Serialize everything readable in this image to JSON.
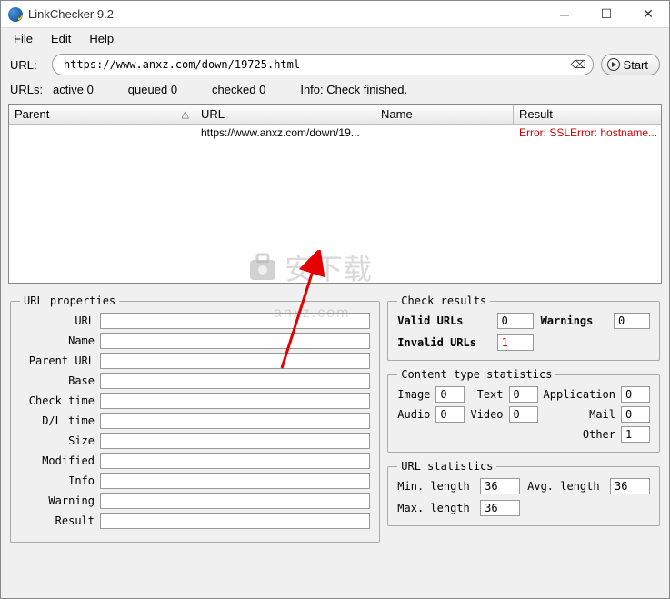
{
  "window": {
    "title": "LinkChecker 9.2"
  },
  "menu": {
    "file": "File",
    "edit": "Edit",
    "help": "Help"
  },
  "url_bar": {
    "label": "URL:",
    "value": "https://www.anxz.com/down/19725.html",
    "start_label": "Start"
  },
  "status": {
    "urls_label": "URLs:",
    "active_label": "active",
    "active_val": "0",
    "queued_label": "queued",
    "queued_val": "0",
    "checked_label": "checked",
    "checked_val": "0",
    "info_label": "Info:",
    "info_val": "Check finished."
  },
  "table": {
    "headers": {
      "parent": "Parent",
      "url": "URL",
      "name": "Name",
      "result": "Result"
    },
    "rows": [
      {
        "parent": "",
        "url": "https://www.anxz.com/down/19...",
        "name": "",
        "result": "Error: SSLError: hostname..."
      }
    ]
  },
  "url_props": {
    "legend": "URL properties",
    "labels": {
      "url": "URL",
      "name": "Name",
      "parent_url": "Parent URL",
      "base": "Base",
      "check_time": "Check time",
      "dl_time": "D/L time",
      "size": "Size",
      "modified": "Modified",
      "info": "Info",
      "warning": "Warning",
      "result": "Result"
    },
    "values": {
      "url": "",
      "name": "",
      "parent_url": "",
      "base": "",
      "check_time": "",
      "dl_time": "",
      "size": "",
      "modified": "",
      "info": "",
      "warning": "",
      "result": ""
    }
  },
  "check_results": {
    "legend": "Check results",
    "valid_label": "Valid URLs",
    "valid_val": "0",
    "warnings_label": "Warnings",
    "warnings_val": "0",
    "invalid_label": "Invalid URLs",
    "invalid_val": "1"
  },
  "content_stats": {
    "legend": "Content type statistics",
    "image_label": "Image",
    "image_val": "0",
    "text_label": "Text",
    "text_val": "0",
    "application_label": "Application",
    "application_val": "0",
    "audio_label": "Audio",
    "audio_val": "0",
    "video_label": "Video",
    "video_val": "0",
    "mail_label": "Mail",
    "mail_val": "0",
    "other_label": "Other",
    "other_val": "1"
  },
  "url_stats": {
    "legend": "URL statistics",
    "min_label": "Min. length",
    "min_val": "36",
    "avg_label": "Avg. length",
    "avg_val": "36",
    "max_label": "Max. length",
    "max_val": "36"
  },
  "watermark": {
    "text": "安下载",
    "sub": "anxz.com"
  }
}
